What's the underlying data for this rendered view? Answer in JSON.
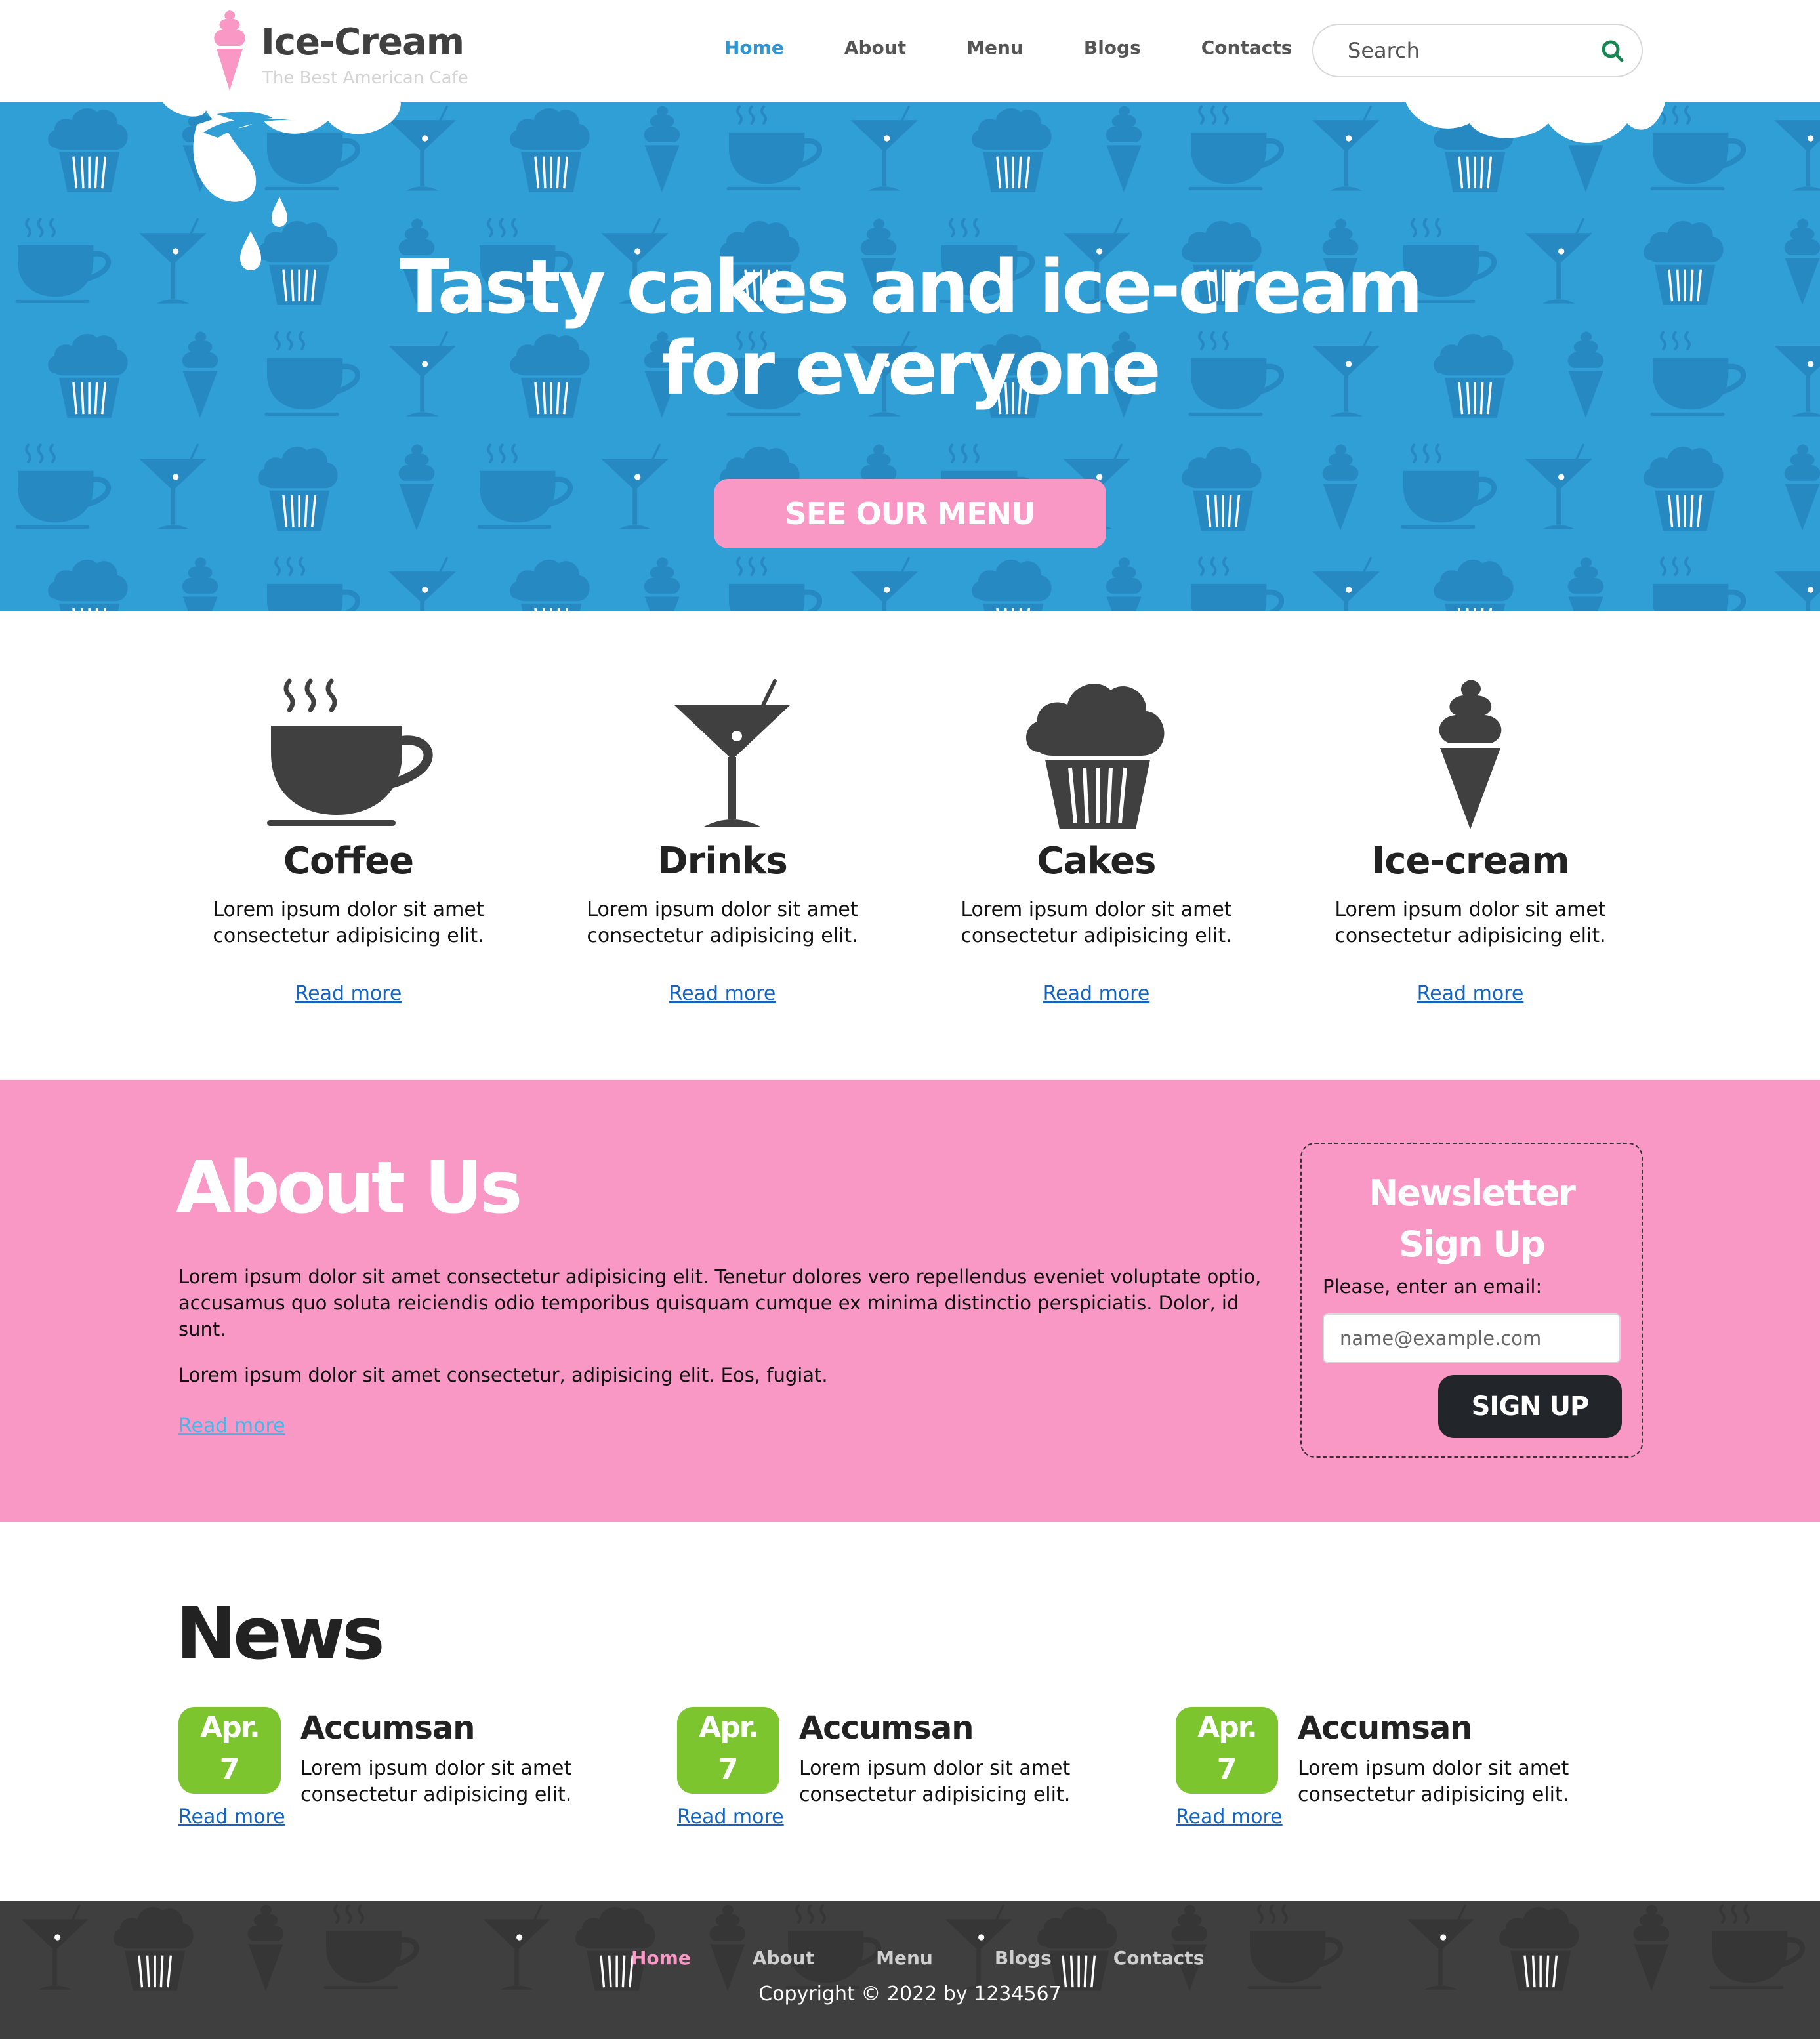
{
  "header": {
    "logo_title": "Ice-Cream",
    "logo_subtitle": "The Best American Cafe",
    "nav": [
      {
        "label": "Home",
        "active": true
      },
      {
        "label": "About",
        "active": false
      },
      {
        "label": "Menu",
        "active": false
      },
      {
        "label": "Blogs",
        "active": false
      },
      {
        "label": "Contacts",
        "active": false
      }
    ],
    "search_placeholder": "Search"
  },
  "hero": {
    "title_line1": "Tasty cakes and ice-cream",
    "title_line2": "for everyone",
    "button_label": "SEE OUR MENU"
  },
  "features": [
    {
      "icon": "coffee-cup-icon",
      "title": "Coffee",
      "text": "Lorem ipsum dolor sit amet consectetur adipisicing elit.",
      "link": "Read more"
    },
    {
      "icon": "cocktail-glass-icon",
      "title": "Drinks",
      "text": "Lorem ipsum dolor sit amet consectetur adipisicing elit.",
      "link": "Read more"
    },
    {
      "icon": "cupcake-icon",
      "title": "Cakes",
      "text": "Lorem ipsum dolor sit amet consectetur adipisicing elit.",
      "link": "Read more"
    },
    {
      "icon": "ice-cream-cone-icon",
      "title": "Ice-cream",
      "text": "Lorem ipsum dolor sit amet consectetur adipisicing elit.",
      "link": "Read more"
    }
  ],
  "about": {
    "title": "About Us",
    "paragraph1": "Lorem ipsum dolor sit amet consectetur adipisicing elit. Tenetur dolores vero repellendus eveniet voluptate optio, accusamus quo soluta reiciendis odio temporibus quisquam cumque ex minima distinctio perspiciatis. Dolor, id sunt.",
    "paragraph2": "Lorem ipsum dolor sit amet consectetur, adipisicing elit. Eos, fugiat.",
    "link": "Read more"
  },
  "newsletter": {
    "title_line1": "Newsletter",
    "title_line2": "Sign Up",
    "label": "Please, enter an email:",
    "placeholder": "name@example.com",
    "button_label": "SIGN UP"
  },
  "news": {
    "title": "News",
    "items": [
      {
        "month": "Apr.",
        "day": "7",
        "title": "Accumsan",
        "text": "Lorem ipsum dolor sit amet consectetur adipisicing elit.",
        "link": "Read more"
      },
      {
        "month": "Apr.",
        "day": "7",
        "title": "Accumsan",
        "text": "Lorem ipsum dolor sit amet consectetur adipisicing elit.",
        "link": "Read more"
      },
      {
        "month": "Apr.",
        "day": "7",
        "title": "Accumsan",
        "text": "Lorem ipsum dolor sit amet consectetur adipisicing elit.",
        "link": "Read more"
      }
    ]
  },
  "footer": {
    "nav": [
      {
        "label": "Home",
        "active": true
      },
      {
        "label": "About",
        "active": false
      },
      {
        "label": "Menu",
        "active": false
      },
      {
        "label": "Blogs",
        "active": false
      },
      {
        "label": "Contacts",
        "active": false
      }
    ],
    "copyright": "Copyright © 2022 by 1234567"
  },
  "colors": {
    "brand_blue": "#2f9fd6",
    "brand_pink": "#f998c4",
    "news_green": "#7cc52f",
    "dark": "#22252a",
    "footer_bg": "#3f3f3f"
  }
}
